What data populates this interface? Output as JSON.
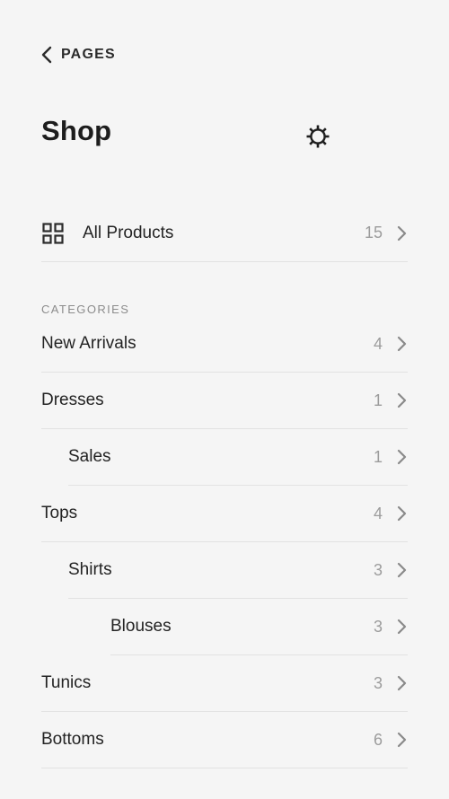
{
  "nav": {
    "back_label": "PAGES"
  },
  "header": {
    "title": "Shop",
    "settings_icon": "gear-icon"
  },
  "all_products": {
    "label": "All Products",
    "count": "15",
    "icon": "grid-icon"
  },
  "categories": {
    "heading": "CATEGORIES",
    "items": [
      {
        "label": "New Arrivals",
        "count": "4",
        "level": 0
      },
      {
        "label": "Dresses",
        "count": "1",
        "level": 0
      },
      {
        "label": "Sales",
        "count": "1",
        "level": 1
      },
      {
        "label": "Tops",
        "count": "4",
        "level": 0
      },
      {
        "label": "Shirts",
        "count": "3",
        "level": 1
      },
      {
        "label": "Blouses",
        "count": "3",
        "level": 2
      },
      {
        "label": "Tunics",
        "count": "3",
        "level": 0
      },
      {
        "label": "Bottoms",
        "count": "6",
        "level": 0
      }
    ]
  },
  "colors": {
    "background": "#f5f5f5",
    "text": "#1f1f1f",
    "muted": "#9c9c9c",
    "divider": "#e2e2e2"
  }
}
